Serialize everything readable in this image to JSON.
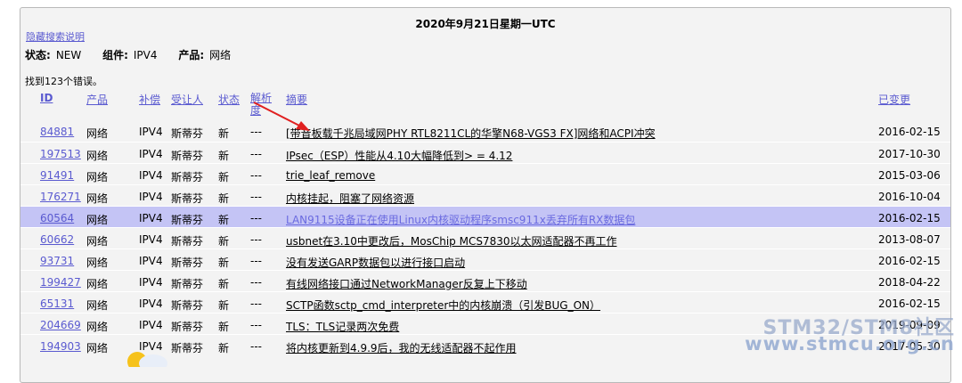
{
  "page": {
    "date_title": "2020年9月21日星期一UTC",
    "hide_link": "隐藏搜索说明",
    "status_label": "状态:",
    "status_value": "NEW",
    "component_label": "组件:",
    "component_value": "IPV4",
    "product_label": "产品:",
    "product_value": "网络",
    "result_count": "找到123个错误。"
  },
  "table": {
    "headers": {
      "id": "ID",
      "product": "产品",
      "comp": "补偿",
      "assignee": "受让人",
      "status": "状态",
      "resolution": "解析度",
      "summary": "摘要",
      "changed": "已变更"
    },
    "rows": [
      {
        "id": "84881",
        "product": "网络",
        "comp": "IPV4",
        "assignee": "斯蒂芬",
        "status": "新",
        "resolution": "---",
        "summary": "[带音板载千兆局域网PHY RTL8211CL的华擎N68-VGS3 FX]网络和ACPI冲突",
        "changed": "2016-02-15"
      },
      {
        "id": "197513",
        "product": "网络",
        "comp": "IPV4",
        "assignee": "斯蒂芬",
        "status": "新",
        "resolution": "---",
        "summary": "IPsec（ESP）性能从4.10大幅降低到> = 4.12",
        "changed": "2017-10-30"
      },
      {
        "id": "91491",
        "product": "网络",
        "comp": "IPV4",
        "assignee": "斯蒂芬",
        "status": "新",
        "resolution": "---",
        "summary": "trie_leaf_remove",
        "changed": "2015-03-06"
      },
      {
        "id": "176271",
        "product": "网络",
        "comp": "IPV4",
        "assignee": "斯蒂芬",
        "status": "新",
        "resolution": "---",
        "summary": "内核挂起，阻塞了网络资源",
        "changed": "2016-10-04"
      },
      {
        "id": "60564",
        "product": "网络",
        "comp": "IPV4",
        "assignee": "斯蒂芬",
        "status": "新",
        "resolution": "---",
        "summary": "LAN9115设备正在使用Linux内核驱动程序smsc911x丢弃所有RX数据包",
        "changed": "2016-02-15",
        "selected": true
      },
      {
        "id": "60662",
        "product": "网络",
        "comp": "IPV4",
        "assignee": "斯蒂芬",
        "status": "新",
        "resolution": "---",
        "summary": "usbnet在3.10中更改后，MosChip MCS7830以太网适配器不再工作",
        "changed": "2013-08-07"
      },
      {
        "id": "93731",
        "product": "网络",
        "comp": "IPV4",
        "assignee": "斯蒂芬",
        "status": "新",
        "resolution": "---",
        "summary": "没有发送GARP数据包以进行接口启动",
        "changed": "2016-02-15"
      },
      {
        "id": "199427",
        "product": "网络",
        "comp": "IPV4",
        "assignee": "斯蒂芬",
        "status": "新",
        "resolution": "---",
        "summary": "有线网络接口通过NetworkManager反复上下移动",
        "changed": "2018-04-22"
      },
      {
        "id": "65131",
        "product": "网络",
        "comp": "IPV4",
        "assignee": "斯蒂芬",
        "status": "新",
        "resolution": "---",
        "summary": "SCTP函数sctp_cmd_interpreter中的内核崩溃（引发BUG_ON）",
        "changed": "2016-02-15"
      },
      {
        "id": "204669",
        "product": "网络",
        "comp": "IPV4",
        "assignee": "斯蒂芬",
        "status": "新",
        "resolution": "---",
        "summary": "TLS：TLS记录两次免费",
        "changed": "2019-09-09"
      },
      {
        "id": "194903",
        "product": "网络",
        "comp": "IPV4",
        "assignee": "斯蒂芬",
        "status": "新",
        "resolution": "---",
        "summary": "将内核更新到4.9.9后，我的无线适配器不起作用",
        "changed": "2017-05-30"
      }
    ]
  },
  "watermark": {
    "line1": "STM32/STM8社区",
    "line2": "www.stmcu.org.cn"
  },
  "colors": {
    "link": "#5a5ad0",
    "selected_row": "#c4c4f5",
    "annotation_arrow": "#e02020"
  },
  "icons": {
    "annotation": "red-arrow-icon",
    "weather": "weather-sun-cloud-icon"
  }
}
